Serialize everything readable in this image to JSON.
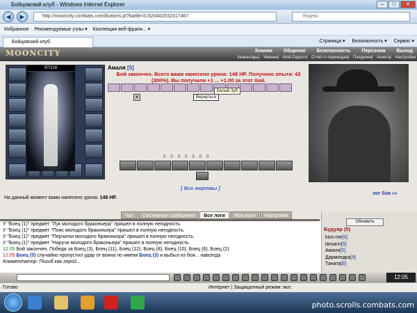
{
  "window": {
    "title": "Бойцовский клуб - Windows Internet Explorer"
  },
  "address": {
    "url": "http://mooncity.combats.com/buttons.pl?battle=0.820402032317467"
  },
  "search": {
    "placeholder": "Яндекс"
  },
  "favorites": {
    "label": "Избранное",
    "items": [
      "Рекомендуемые узлы ▾",
      "Коллекция веб-фрагм... ▾"
    ]
  },
  "tab": {
    "label": "Бойцовский клуб"
  },
  "commands": [
    "Страница ▾",
    "Безопасность ▾",
    "Сервис ▾"
  ],
  "game": {
    "logo": "MOONCITY",
    "menu": [
      "Знания",
      "Общение",
      "Безопасность",
      "Персонаж",
      "Выход"
    ],
    "submenu": [
      "Инвентарь",
      "Умения",
      "Мой Скролл",
      "Отчет о переводах",
      "Поединки",
      "Анкета",
      "Настройки"
    ],
    "char_hp": "97/316",
    "char_name": "Амаля",
    "char_level": "[5]",
    "battle_result": "Бой закончен. Всего вами нанесено урона: 148 HP. Получено опыта: 42 (300%). Вы получили +1 ... +1.00 за этот бой.",
    "tooltip": "Белый Зуб",
    "back_button": "Вернуться",
    "stats": [
      "0",
      "0",
      "0",
      "0",
      "0",
      "0",
      "0"
    ],
    "all_dead": "[ Все мертвы ]",
    "battle_log_link": "лог боя »»",
    "damage_line_prefix": "На данный момент вами нанесено урона:",
    "damage_line_value": "148 HP."
  },
  "chat": {
    "tabs": [
      "Чат",
      "Системные сообщения",
      "Все логи",
      "Мои логи",
      "Настройки"
    ],
    "active_tab": "Все логи",
    "lines": [
      "У \"Боец (1)\" предмет \"Лук молодого браконьера\" пришел в полную негодность.",
      "У \"Боец (1)\" предмет \"Пояс молодого браконьера\" пришел в полную негодность.",
      "У \"Боец (1)\" предмет \"Перчатки молодого браконьера\" пришел в полную негодность.",
      "У \"Боец (1)\" предмет \"Наручи молодого браконьера\" пришел в полную негодность."
    ],
    "time1": "12:05",
    "line5": "Бой закончен. Победа за Боец (3), Боец (11), Боец (12), Боец (8), Боец (10), Боец (6), Боец (2)",
    "time2": "12:05",
    "line6_name": "Боец (5)",
    "line6_text": "случайно пропустил удар от воина по имени",
    "line6_name2": "Боец (3)",
    "line6_tail": "и выбыл из боя... навсегда",
    "line7": "Комментатор: Погиб как герой..."
  },
  "room": {
    "refresh": "Обновить",
    "name": "Будуар (5)",
    "players": [
      {
        "name": "kiss-me",
        "level": "[6]"
      },
      {
        "name": "larsann",
        "level": "[5]"
      },
      {
        "name": "Амаля",
        "level": "[5]"
      },
      {
        "name": "Дармоедка",
        "level": "[9]"
      },
      {
        "name": "Таната",
        "level": "[6]"
      }
    ]
  },
  "clock": "12:05",
  "status": {
    "left": "Готово",
    "zone": "Интернет | Защищенный режим: вкл."
  },
  "watermark": "photo.scrolls.combats.com"
}
